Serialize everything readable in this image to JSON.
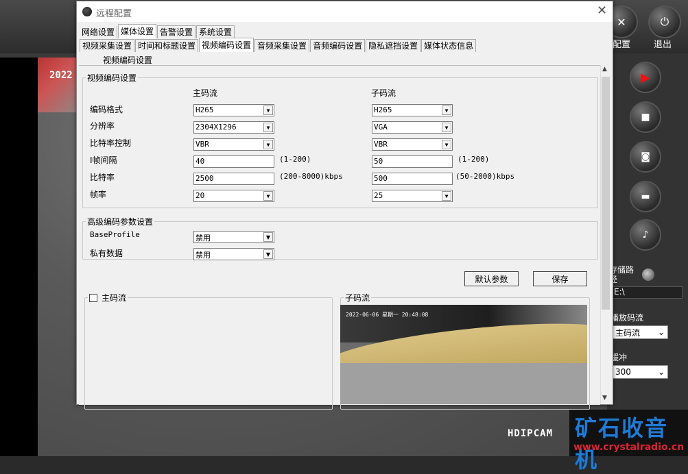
{
  "background_app": {
    "video_timestamp": "2022",
    "video_brand": "HDIPCAM",
    "top_buttons": [
      {
        "label": "配置",
        "icon": "config-icon"
      },
      {
        "label": "退出",
        "icon": "power-icon"
      }
    ],
    "side_controls": [
      {
        "icon": "record-icon"
      },
      {
        "icon": "stop-icon"
      },
      {
        "icon": "camera-icon"
      },
      {
        "icon": "clapper-icon"
      },
      {
        "icon": "microphone-icon"
      }
    ],
    "storage_path_label": "存储路径",
    "storage_path_value": "E:\\",
    "playback_stream_label": "播放码流",
    "playback_stream_value": "主码流",
    "buffer_label": "缓冲",
    "buffer_value": "300"
  },
  "dialog": {
    "title": "远程配置",
    "tabs_row1": [
      "网络设置",
      "媒体设置",
      "告警设置",
      "系统设置"
    ],
    "tabs_row1_active": 1,
    "tabs_row2": [
      "视频采集设置",
      "时间和标题设置",
      "视频编码设置",
      "音频采集设置",
      "音频编码设置",
      "隐私遮挡设置",
      "媒体状态信息"
    ],
    "tabs_row2_active": 2,
    "subheader": "视频编码设置",
    "video_encoding": {
      "legend": "视频编码设置",
      "main_header": "主码流",
      "sub_header": "子码流",
      "rows": {
        "codec": {
          "label": "编码格式",
          "main": "H265",
          "sub": "H265"
        },
        "resolution": {
          "label": "分辨率",
          "main": "2304X1296",
          "sub": "VGA"
        },
        "bitrate_control": {
          "label": "比特率控制",
          "main": "VBR",
          "sub": "VBR"
        },
        "iframe_interval": {
          "label": "I帧间隔",
          "main": "40",
          "sub": "50",
          "main_range": "(1-200)",
          "sub_range": "(1-200)"
        },
        "bitrate": {
          "label": "比特率",
          "main": "2500",
          "sub": "500",
          "main_range": "(200-8000)kbps",
          "sub_range": "(50-2000)kbps"
        },
        "framerate": {
          "label": "帧率",
          "main": "20",
          "sub": "25"
        }
      }
    },
    "advanced": {
      "legend": "高级编码参数设置",
      "base_profile_label": "BaseProfile",
      "base_profile_value": "禁用",
      "private_data_label": "私有数据",
      "private_data_value": "禁用"
    },
    "buttons": {
      "default": "默认参数",
      "save": "保存"
    },
    "preview": {
      "main_label": "主码流",
      "sub_label": "子码流",
      "sub_timestamp": "2022-06-06 星期一 20:48:08"
    }
  },
  "watermark": {
    "main": "矿石收音机",
    "url": "www.crystalradio.cn"
  }
}
